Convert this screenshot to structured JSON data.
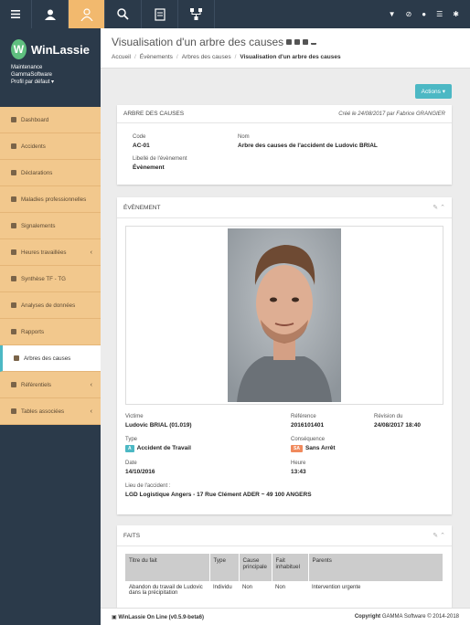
{
  "sidebar": {
    "brand": "WinLassie",
    "org_line1": "Maintenance",
    "org_line2": "GammaSoftware",
    "profile": "Profil par défaut",
    "items": [
      {
        "label": "Dashboard"
      },
      {
        "label": "Accidents"
      },
      {
        "label": "Déclarations"
      },
      {
        "label": "Maladies professionnelles"
      },
      {
        "label": "Signalements"
      },
      {
        "label": "Heures travaillées"
      },
      {
        "label": "Synthèse TF - TG"
      },
      {
        "label": "Analyses de données"
      },
      {
        "label": "Rapports"
      },
      {
        "label": "Arbres des causes"
      },
      {
        "label": "Référentiels"
      },
      {
        "label": "Tables associées"
      }
    ]
  },
  "header": {
    "title": "Visualisation d'un arbre des causes",
    "breadcrumb": [
      "Accueil",
      "Évènements",
      "Arbres des causes",
      "Visualisation d'un arbre des causes"
    ]
  },
  "actions_label": "Actions ▾",
  "arbre": {
    "title": "ARBRE DES CAUSES",
    "created": "Créé le 24/08/2017 par Fabrice GRANGIER",
    "code_label": "Code",
    "code": "AC-01",
    "nom_label": "Nom",
    "nom": "Arbre des causes de l'accident de Ludovic BRIAL",
    "libelle_label": "Libellé de l'évènement",
    "libelle": "Évènement"
  },
  "evenement": {
    "title": "ÉVÈNEMENT",
    "victime_label": "Victime",
    "victime": "Ludovic BRIAL (01.019)",
    "reference_label": "Référence",
    "reference": "2016101401",
    "revision_label": "Révision du",
    "revision": "24/08/2017 18:40",
    "type_label": "Type",
    "type_badge": "A",
    "type": "Accident de Travail",
    "consequence_label": "Conséquence",
    "consequence_badge": "SA",
    "consequence": "Sans Arrêt",
    "date_label": "Date",
    "date": "14/10/2016",
    "heure_label": "Heure",
    "heure": "13:43",
    "lieu_label": "Lieu de l'accident :",
    "lieu": "LGD Logistique Angers - 17 Rue Clément ADER ~ 49 100 ANGERS"
  },
  "faits": {
    "title": "FAITS",
    "headers": [
      "Titre du fait",
      "Type",
      "Cause principale",
      "Fait inhabituel",
      "Parents"
    ],
    "rows": [
      [
        "Abandon du travail de Ludovic dans la précipitation",
        "Individu",
        "Non",
        "Non",
        "Intervention urgente"
      ]
    ]
  },
  "footer": {
    "left": "WinLassie On Line (v0.5.9-beta6)",
    "right_bold": "Copyright",
    "right": "GAMMA Software © 2014-2018"
  },
  "colors": {
    "sidebar": "#2b3a4a",
    "menu": "#f2c88d",
    "accent": "#4cb8c4",
    "badge_a": "#4cb8c4",
    "badge_sa": "#f08a5d"
  }
}
